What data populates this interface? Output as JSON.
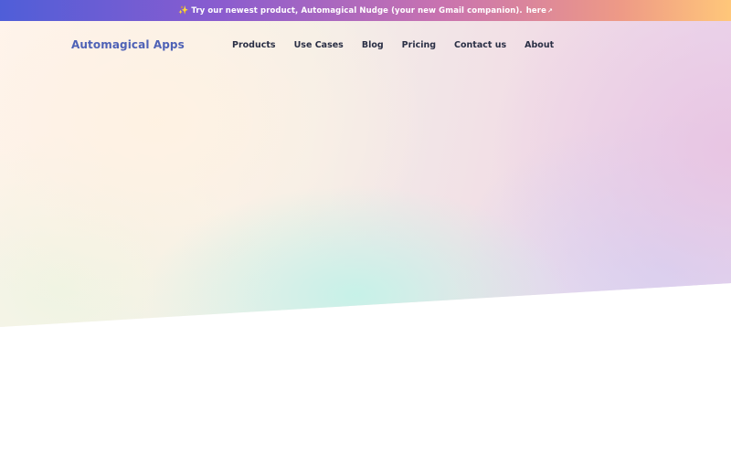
{
  "announcement": {
    "icon": "sparkles-icon",
    "emoji": "✨",
    "text": "Try our newest product, Automagical Nudge (your new Gmail companion).",
    "link_text": "here",
    "link_icon": "↗"
  },
  "header": {
    "logo": "Automagical Apps",
    "nav": [
      {
        "label": "Products"
      },
      {
        "label": "Use Cases"
      },
      {
        "label": "Blog"
      },
      {
        "label": "Pricing"
      },
      {
        "label": "Contact us"
      },
      {
        "label": "About"
      }
    ]
  },
  "colors": {
    "brand": "#4e62b6",
    "nav_text": "#2a2f45",
    "banner_start": "#4f5ed8",
    "banner_end": "#ffc77a"
  }
}
